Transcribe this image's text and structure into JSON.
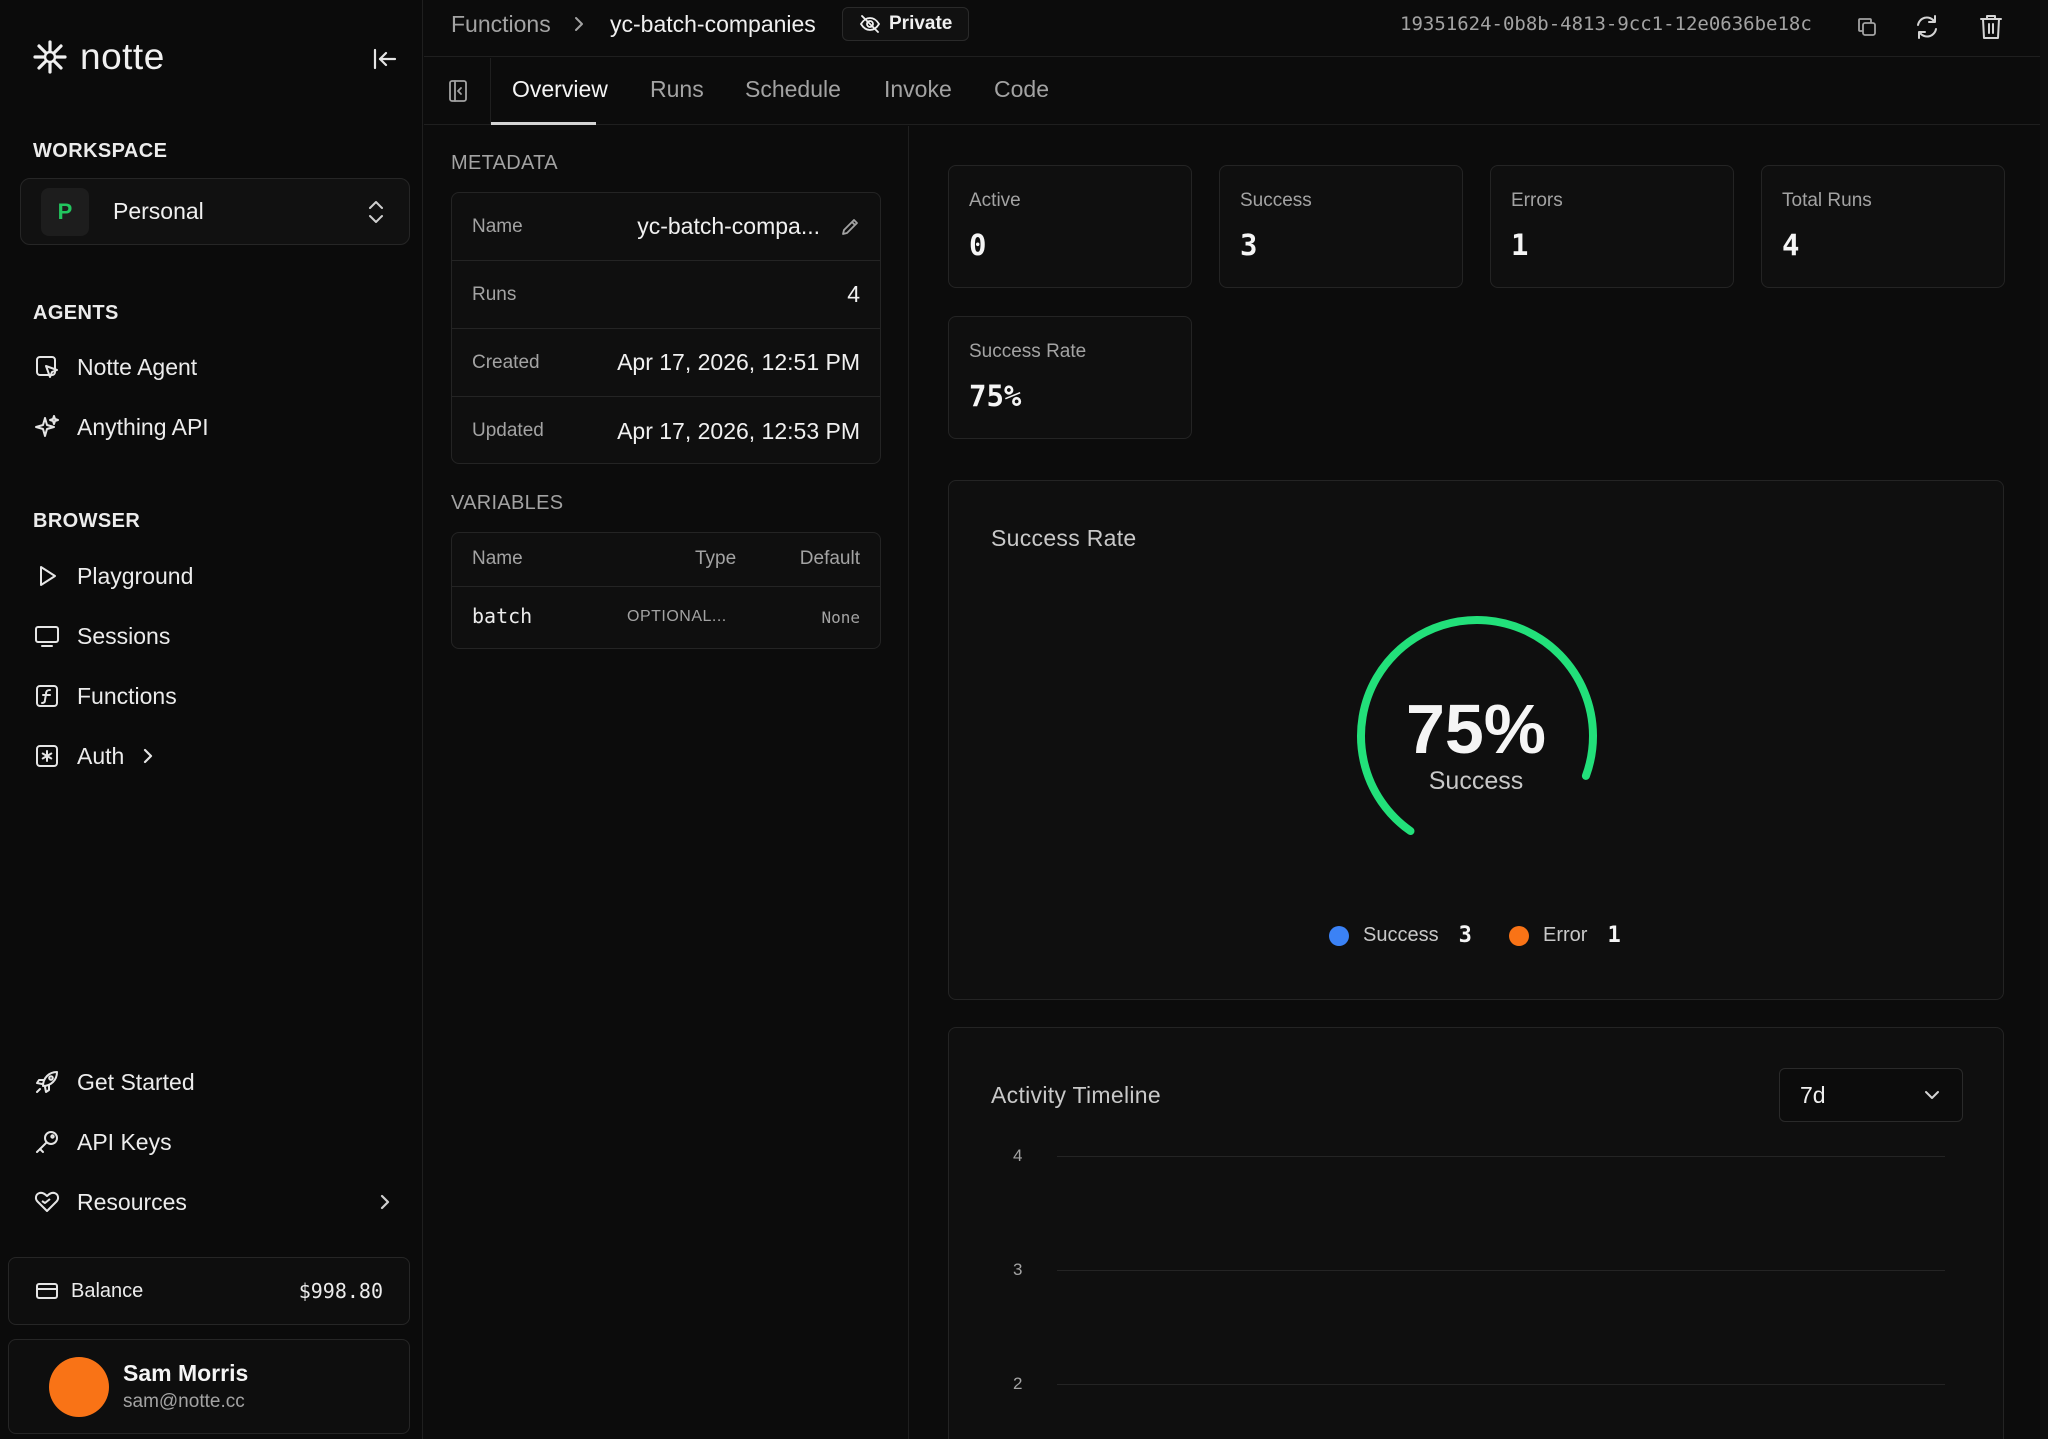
{
  "app": {
    "logo_text": "notte"
  },
  "sidebar": {
    "workspace_title": "WORKSPACE",
    "workspace": {
      "initial": "P",
      "name": "Personal"
    },
    "agents_title": "AGENTS",
    "agents": [
      {
        "label": "Notte Agent",
        "icon": "agent-icon"
      },
      {
        "label": "Anything API",
        "icon": "sparkles-icon"
      }
    ],
    "browser_title": "BROWSER",
    "browser": [
      {
        "label": "Playground",
        "icon": "play-icon"
      },
      {
        "label": "Sessions",
        "icon": "monitor-icon"
      },
      {
        "label": "Functions",
        "icon": "function-icon"
      },
      {
        "label": "Auth",
        "icon": "auth-icon"
      }
    ],
    "bottom": [
      {
        "label": "Get Started",
        "icon": "rocket-icon"
      },
      {
        "label": "API Keys",
        "icon": "key-icon"
      },
      {
        "label": "Resources",
        "icon": "resources-icon"
      }
    ],
    "balance": {
      "label": "Balance",
      "value": "$998.80"
    },
    "user": {
      "name": "Sam Morris",
      "email": "sam@notte.cc"
    }
  },
  "header": {
    "breadcrumb_parent": "Functions",
    "breadcrumb_current": "yc-batch-companies",
    "visibility": "Private",
    "function_id": "19351624-0b8b-4813-9cc1-12e0636be18c"
  },
  "tabs": [
    {
      "label": "Overview",
      "active": true
    },
    {
      "label": "Runs",
      "active": false
    },
    {
      "label": "Schedule",
      "active": false
    },
    {
      "label": "Invoke",
      "active": false
    },
    {
      "label": "Code",
      "active": false
    }
  ],
  "metadata": {
    "title": "METADATA",
    "rows": [
      {
        "key": "Name",
        "value": "yc-batch-compa..."
      },
      {
        "key": "Runs",
        "value": "4"
      },
      {
        "key": "Created",
        "value": "Apr 17, 2026, 12:51 PM"
      },
      {
        "key": "Updated",
        "value": "Apr 17, 2026, 12:53 PM"
      }
    ]
  },
  "variables": {
    "title": "VARIABLES",
    "headers": [
      "Name",
      "Type",
      "Default"
    ],
    "rows": [
      {
        "name": "batch",
        "type": "OPTIONAL...",
        "default": "None"
      }
    ]
  },
  "stats": [
    {
      "label": "Active",
      "value": "0"
    },
    {
      "label": "Success",
      "value": "3"
    },
    {
      "label": "Errors",
      "value": "1"
    },
    {
      "label": "Total Runs",
      "value": "4"
    },
    {
      "label": "Success Rate",
      "value": "75%"
    }
  ],
  "success_rate_card": {
    "title": "Success Rate",
    "percent_text": "75%",
    "percent_value": 75,
    "sublabel": "Success",
    "legend": [
      {
        "name": "Success",
        "count": "3",
        "color": "#3b82f6"
      },
      {
        "name": "Error",
        "count": "1",
        "color": "#f97316"
      }
    ],
    "arc_color": "#22e07a"
  },
  "activity_timeline": {
    "title": "Activity Timeline",
    "range": "7d",
    "y_ticks": [
      "4",
      "3",
      "2"
    ]
  }
}
